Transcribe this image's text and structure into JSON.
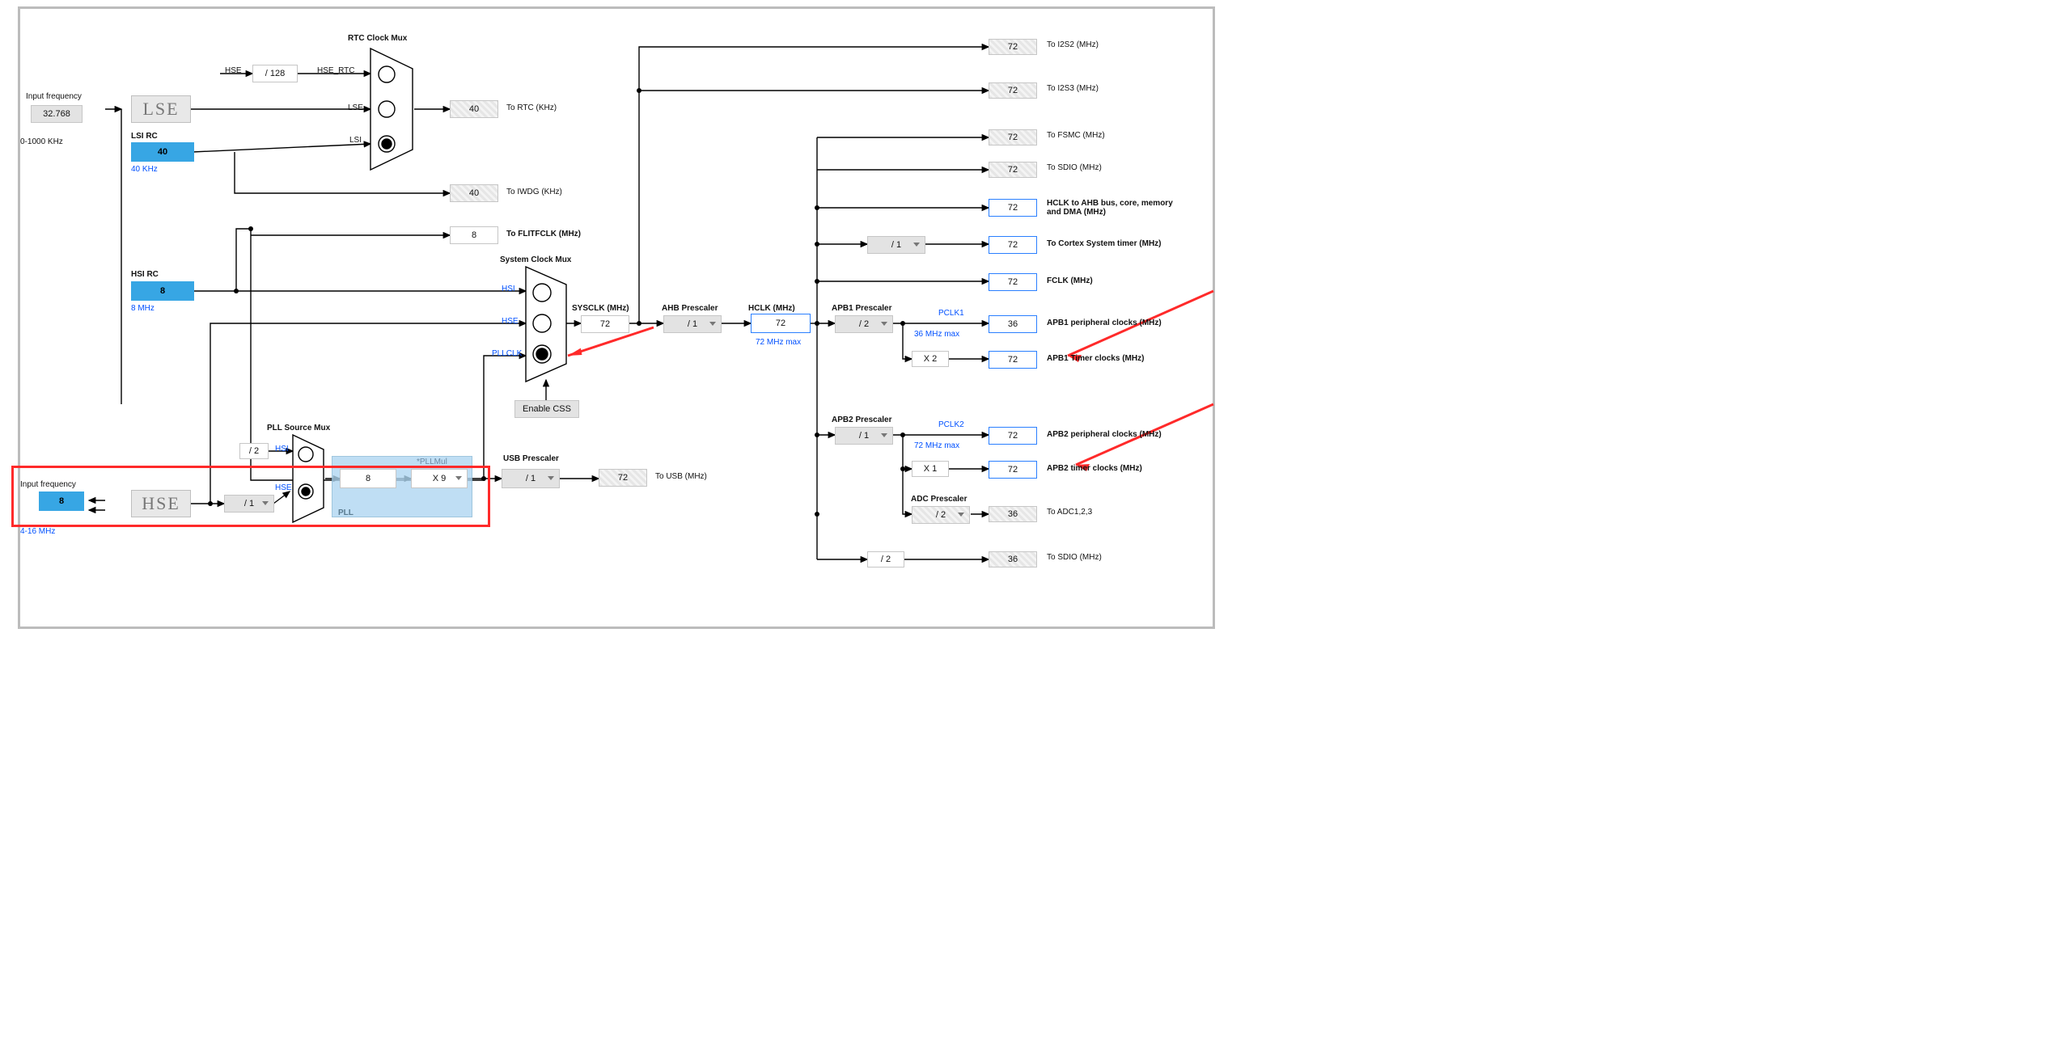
{
  "labels": {
    "input_freq1": "Input frequency",
    "input_freq1_range": "0-1000 KHz",
    "input_freq2": "Input frequency",
    "input_freq2_range": "4-16 MHz",
    "lse": "LSE",
    "lsi_rc": "LSI RC",
    "lsi_hint": "40 KHz",
    "hsi_rc": "HSI RC",
    "hsi_hint": "8 MHz",
    "hse": "HSE",
    "rtc_mux": "RTC Clock Mux",
    "pll_src_mux": "PLL Source Mux",
    "sys_mux": "System Clock Mux",
    "hse_line": "HSE",
    "hse_rtc": "HSE_RTC",
    "lse_line": "LSE",
    "lsi_line": "LSI",
    "hsi_line": "HSI",
    "hse_sys": "HSE",
    "pllclk": "PLLCLK",
    "pll_mul": "*PLLMul",
    "pll": "PLL",
    "enable_css": "Enable CSS",
    "sysclk": "SYSCLK (MHz)",
    "usb_pre": "USB Prescaler",
    "ahb_pre": "AHB Prescaler",
    "hclk": "HCLK (MHz)",
    "hclk_max": "72 MHz max",
    "apb1_pre": "APB1 Prescaler",
    "apb2_pre": "APB2 Prescaler",
    "pclk1": "PCLK1",
    "pclk1_max": "36 MHz max",
    "pclk2": "PCLK2",
    "pclk2_max": "72 MHz max",
    "adc_pre": "ADC Prescaler",
    "to_rtc": "To RTC (KHz)",
    "to_iwdg": "To IWDG (KHz)",
    "to_flit": "To FLITFCLK (MHz)",
    "to_usb": "To USB (MHz)",
    "to_i2s2": "To I2S2 (MHz)",
    "to_i2s3": "To I2S3 (MHz)",
    "to_fsmc": "To FSMC (MHz)",
    "to_sdio": "To SDIO (MHz)",
    "hclk_out": "HCLK to AHB bus, core, memory and DMA (MHz)",
    "to_cortex": "To Cortex System timer (MHz)",
    "fclk": "FCLK (MHz)",
    "apb1_periph": "APB1 peripheral clocks (MHz)",
    "apb1_timer": "APB1 Timer clocks (MHz)",
    "apb2_periph": "APB2 peripheral clocks (MHz)",
    "apb2_timer": "APB2 timer clocks (MHz)",
    "to_adc": "To ADC1,2,3",
    "to_sdio2": "To SDIO (MHz)"
  },
  "values": {
    "in1": "32.768",
    "in2": "8",
    "lsi": "40",
    "hsi": "8",
    "div128": "/ 128",
    "rtc": "40",
    "iwdg": "40",
    "flit": "8",
    "div2": "/ 2",
    "hse_div": "/ 1",
    "pll_in": "8",
    "pll_mul": "X 9",
    "sysclk": "72",
    "usb_div": "/ 1",
    "usb": "72",
    "ahb": "/ 1",
    "hclk": "72",
    "apb1": "/ 2",
    "apb1_x": "X 2",
    "apb2": "/ 1",
    "apb2_x": "X 1",
    "cortex": "/ 1",
    "adc": "/ 2",
    "sdio2": "/ 2",
    "out_i2s2": "72",
    "out_i2s3": "72",
    "out_fsmc": "72",
    "out_sdio": "72",
    "out_hclk": "72",
    "out_cortex": "72",
    "out_fclk": "72",
    "out_apb1p": "36",
    "out_apb1t": "72",
    "out_apb2p": "72",
    "out_apb2t": "72",
    "out_adc": "36",
    "out_sdio2": "36"
  }
}
